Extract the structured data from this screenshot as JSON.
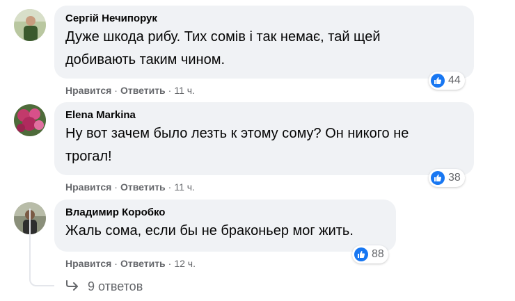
{
  "comments": [
    {
      "author": "Сергій Нечипорук",
      "text_lines": [
        "Дуже шкода рибу. Тих сомів і так немає, тай щей",
        "добивають таким чином."
      ],
      "like_label": "Нравится",
      "reply_label": "Ответить",
      "time": "11 ч.",
      "reaction_count": "44"
    },
    {
      "author": "Elena Markina",
      "text_lines": [
        "Ну вот зачем было лезть к этому сому? Он никого не",
        "трогал!"
      ],
      "like_label": "Нравится",
      "reply_label": "Ответить",
      "time": "11 ч.",
      "reaction_count": "38"
    },
    {
      "author": "Владимир Коробко",
      "text_lines": [
        "Жаль сома, если бы не браконьер мог жить."
      ],
      "like_label": "Нравится",
      "reply_label": "Ответить",
      "time": "12 ч.",
      "reaction_count": "88"
    }
  ],
  "separator": "·",
  "replies_link": "9 ответов",
  "colors": {
    "bubble": "#f0f2f5",
    "like_badge": "#1877f2",
    "meta_text": "#65676b",
    "thread_line": "#e4e6eb"
  },
  "icons": [
    "like-icon",
    "reply-arrow-icon"
  ]
}
